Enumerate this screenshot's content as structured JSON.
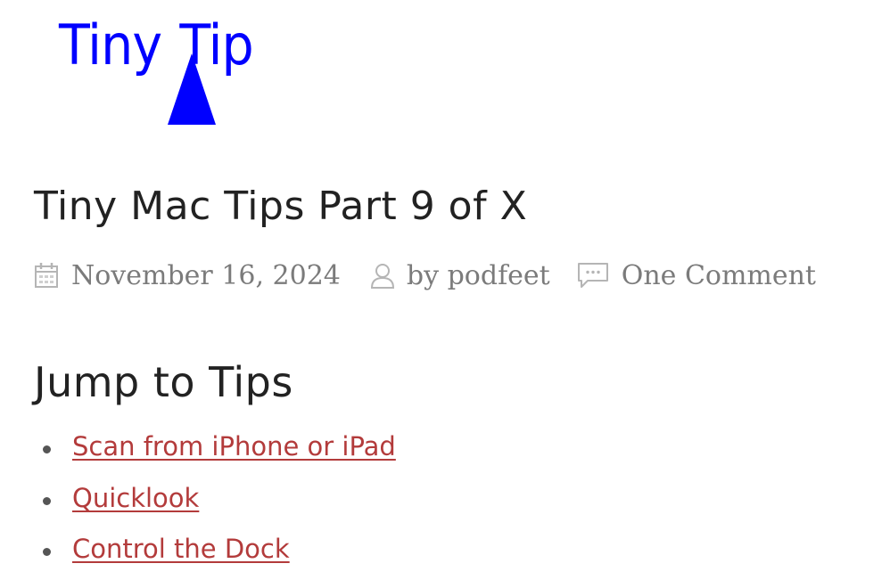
{
  "logo": {
    "text_left": "Tiny",
    "text_right": "Tip",
    "color": "#0000ff"
  },
  "post": {
    "title": "Tiny Mac Tips Part 9 of X",
    "date": "November 16, 2024",
    "author_prefix": "by ",
    "author": "podfeet",
    "comments": "One Comment"
  },
  "icons": {
    "date": "calendar-icon",
    "author": "user-icon",
    "comments": "comment-icon"
  },
  "jump": {
    "heading": "Jump to Tips",
    "items": [
      {
        "label": "Scan from iPhone or iPad"
      },
      {
        "label": "Quicklook"
      },
      {
        "label": "Control the Dock"
      }
    ]
  },
  "colors": {
    "link": "#b33b3b",
    "heading": "#222222",
    "meta_text": "#7b7b7b",
    "meta_icon": "#b5b5b5"
  }
}
